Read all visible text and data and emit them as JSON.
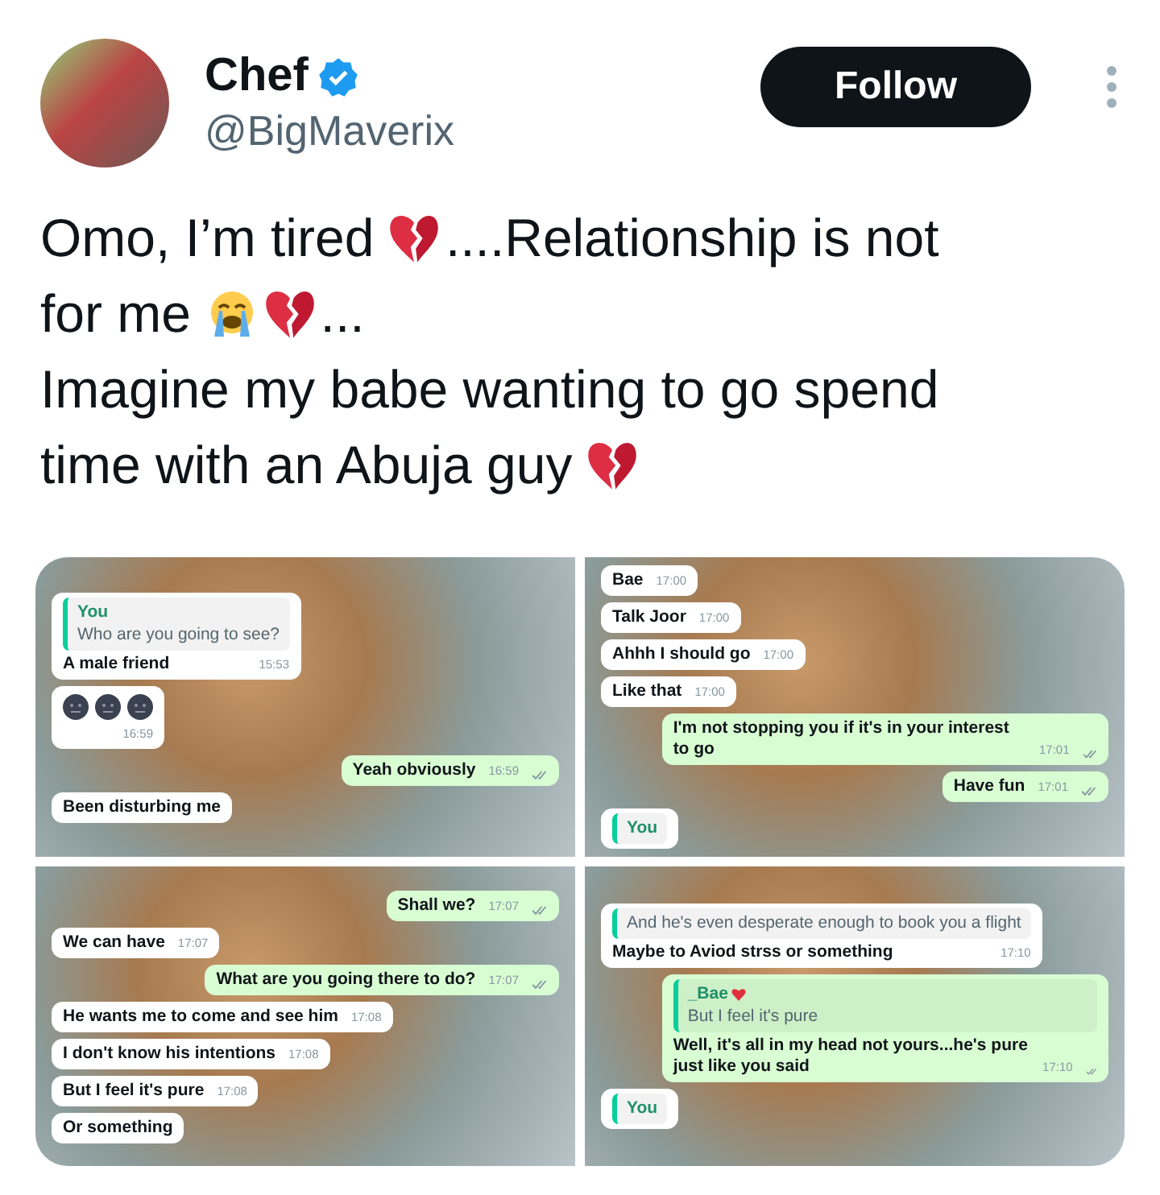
{
  "author": {
    "name": "Chef",
    "verified": true,
    "handle": "@BigMaverix"
  },
  "follow_button": "Follow",
  "tweet": [
    [
      {
        "kind": "text",
        "text": "Omo, I’m tired"
      },
      {
        "kind": "broken-heart"
      },
      {
        "kind": "text",
        "text": "....Relationship is not"
      },
      {
        "kind": "text",
        "text": "for me"
      },
      {
        "kind": "crying-face"
      },
      {
        "kind": "broken-heart"
      },
      {
        "kind": "text",
        "text": "..."
      }
    ],
    [
      {
        "kind": "text",
        "text": "Imagine my babe wanting to go spend"
      },
      {
        "kind": "text",
        "text": "time with an Abuja guy"
      },
      {
        "kind": "broken-heart"
      }
    ]
  ],
  "screenshots": [
    {
      "messages": [
        {
          "kind": "received",
          "quote": {
            "author": "You",
            "text": "Who are you going to see?"
          },
          "text": "A male friend",
          "time": "15:53"
        },
        {
          "kind": "emoji",
          "time": "16:59"
        },
        {
          "kind": "sent",
          "text": "Yeah obviously",
          "time": "16:59"
        },
        {
          "kind": "received",
          "text": "Been disturbing me"
        }
      ]
    },
    {
      "messages": [
        {
          "kind": "received",
          "text": "Bae",
          "time": "17:00"
        },
        {
          "kind": "received",
          "text": "Talk Joor",
          "time": "17:00"
        },
        {
          "kind": "received",
          "text": "Ahhh I should go",
          "time": "17:00"
        },
        {
          "kind": "received",
          "text": "Like that",
          "time": "17:00"
        },
        {
          "kind": "sent",
          "text": "I'm not stopping you if it's in your interest to go",
          "time": "17:01"
        },
        {
          "kind": "sent",
          "text": "Have fun",
          "time": "17:01"
        },
        {
          "kind": "received",
          "quote": {
            "author": "You"
          }
        }
      ]
    },
    {
      "messages": [
        {
          "kind": "sent",
          "text": "Shall we?",
          "time": "17:07"
        },
        {
          "kind": "received",
          "text": "We can have",
          "time": "17:07"
        },
        {
          "kind": "sent",
          "text": "What are you going there to do?",
          "time": "17:07"
        },
        {
          "kind": "received",
          "text": "He wants me to come and see him",
          "time": "17:08"
        },
        {
          "kind": "received",
          "text": "I don't know his intentions",
          "time": "17:08"
        },
        {
          "kind": "received",
          "text": "But I feel it's pure",
          "time": "17:08"
        },
        {
          "kind": "received",
          "text": "Or something"
        }
      ]
    },
    {
      "messages": [
        {
          "kind": "received",
          "quote": {
            "text": "And he's even desperate enough to book you a flight"
          },
          "text": "Maybe to Aviod strss or something",
          "time": "17:10"
        },
        {
          "kind": "sent",
          "quote": {
            "author": "_Bae",
            "heart": true,
            "text": "But I feel it's pure"
          },
          "text": "Well, it's all in my head not yours...he's pure just like you said",
          "time": "17:10"
        },
        {
          "kind": "received",
          "quote": {
            "author": "You"
          }
        }
      ]
    }
  ]
}
